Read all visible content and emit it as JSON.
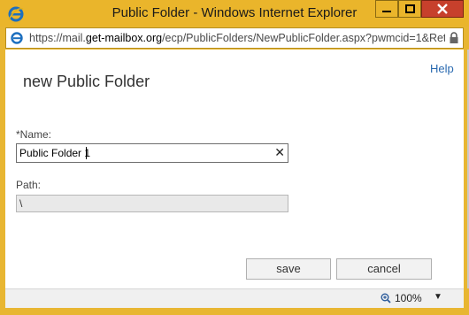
{
  "window": {
    "title": "Public Folder - Windows Internet Explorer",
    "controls": {
      "minimize": "▁",
      "maximize": "☐",
      "close": "✕"
    }
  },
  "address_bar": {
    "url_prefix": "https://mail.",
    "url_domain": "get-mailbox.org",
    "url_path": "/ecp/PublicFolders/NewPublicFolder.aspx?pwmcid=1&Retu"
  },
  "page": {
    "help": "Help",
    "title": "new Public Folder",
    "name_label": "*Name:",
    "name_value": "Public Folder 1",
    "clear_symbol": "✕",
    "path_label": "Path:",
    "path_value": "\\",
    "save": "save",
    "cancel": "cancel"
  },
  "status_bar": {
    "zoom": "100%",
    "zoom_arrow": "▼"
  },
  "colors": {
    "title_bar": "#eab52b",
    "close_button": "#c7402c",
    "link": "#2a6ab0"
  },
  "icons": [
    "ie-logo-icon",
    "ie-page-icon",
    "lock-icon",
    "zoom-icon"
  ]
}
